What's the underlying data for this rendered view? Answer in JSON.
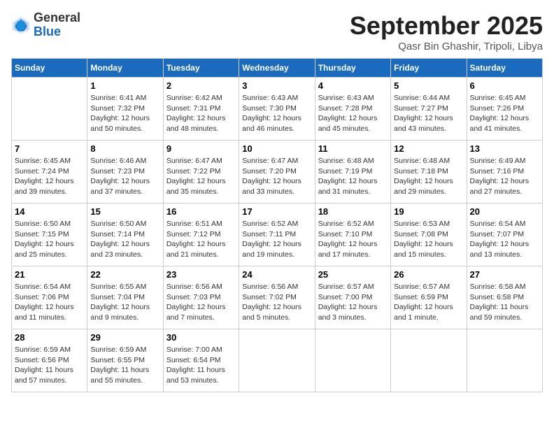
{
  "header": {
    "logo_general": "General",
    "logo_blue": "Blue",
    "month_title": "September 2025",
    "location": "Qasr Bin Ghashir, Tripoli, Libya"
  },
  "weekdays": [
    "Sunday",
    "Monday",
    "Tuesday",
    "Wednesday",
    "Thursday",
    "Friday",
    "Saturday"
  ],
  "weeks": [
    [
      {
        "day": "",
        "sunrise": "",
        "sunset": "",
        "daylight": ""
      },
      {
        "day": "1",
        "sunrise": "Sunrise: 6:41 AM",
        "sunset": "Sunset: 7:32 PM",
        "daylight": "Daylight: 12 hours and 50 minutes."
      },
      {
        "day": "2",
        "sunrise": "Sunrise: 6:42 AM",
        "sunset": "Sunset: 7:31 PM",
        "daylight": "Daylight: 12 hours and 48 minutes."
      },
      {
        "day": "3",
        "sunrise": "Sunrise: 6:43 AM",
        "sunset": "Sunset: 7:30 PM",
        "daylight": "Daylight: 12 hours and 46 minutes."
      },
      {
        "day": "4",
        "sunrise": "Sunrise: 6:43 AM",
        "sunset": "Sunset: 7:28 PM",
        "daylight": "Daylight: 12 hours and 45 minutes."
      },
      {
        "day": "5",
        "sunrise": "Sunrise: 6:44 AM",
        "sunset": "Sunset: 7:27 PM",
        "daylight": "Daylight: 12 hours and 43 minutes."
      },
      {
        "day": "6",
        "sunrise": "Sunrise: 6:45 AM",
        "sunset": "Sunset: 7:26 PM",
        "daylight": "Daylight: 12 hours and 41 minutes."
      }
    ],
    [
      {
        "day": "7",
        "sunrise": "Sunrise: 6:45 AM",
        "sunset": "Sunset: 7:24 PM",
        "daylight": "Daylight: 12 hours and 39 minutes."
      },
      {
        "day": "8",
        "sunrise": "Sunrise: 6:46 AM",
        "sunset": "Sunset: 7:23 PM",
        "daylight": "Daylight: 12 hours and 37 minutes."
      },
      {
        "day": "9",
        "sunrise": "Sunrise: 6:47 AM",
        "sunset": "Sunset: 7:22 PM",
        "daylight": "Daylight: 12 hours and 35 minutes."
      },
      {
        "day": "10",
        "sunrise": "Sunrise: 6:47 AM",
        "sunset": "Sunset: 7:20 PM",
        "daylight": "Daylight: 12 hours and 33 minutes."
      },
      {
        "day": "11",
        "sunrise": "Sunrise: 6:48 AM",
        "sunset": "Sunset: 7:19 PM",
        "daylight": "Daylight: 12 hours and 31 minutes."
      },
      {
        "day": "12",
        "sunrise": "Sunrise: 6:48 AM",
        "sunset": "Sunset: 7:18 PM",
        "daylight": "Daylight: 12 hours and 29 minutes."
      },
      {
        "day": "13",
        "sunrise": "Sunrise: 6:49 AM",
        "sunset": "Sunset: 7:16 PM",
        "daylight": "Daylight: 12 hours and 27 minutes."
      }
    ],
    [
      {
        "day": "14",
        "sunrise": "Sunrise: 6:50 AM",
        "sunset": "Sunset: 7:15 PM",
        "daylight": "Daylight: 12 hours and 25 minutes."
      },
      {
        "day": "15",
        "sunrise": "Sunrise: 6:50 AM",
        "sunset": "Sunset: 7:14 PM",
        "daylight": "Daylight: 12 hours and 23 minutes."
      },
      {
        "day": "16",
        "sunrise": "Sunrise: 6:51 AM",
        "sunset": "Sunset: 7:12 PM",
        "daylight": "Daylight: 12 hours and 21 minutes."
      },
      {
        "day": "17",
        "sunrise": "Sunrise: 6:52 AM",
        "sunset": "Sunset: 7:11 PM",
        "daylight": "Daylight: 12 hours and 19 minutes."
      },
      {
        "day": "18",
        "sunrise": "Sunrise: 6:52 AM",
        "sunset": "Sunset: 7:10 PM",
        "daylight": "Daylight: 12 hours and 17 minutes."
      },
      {
        "day": "19",
        "sunrise": "Sunrise: 6:53 AM",
        "sunset": "Sunset: 7:08 PM",
        "daylight": "Daylight: 12 hours and 15 minutes."
      },
      {
        "day": "20",
        "sunrise": "Sunrise: 6:54 AM",
        "sunset": "Sunset: 7:07 PM",
        "daylight": "Daylight: 12 hours and 13 minutes."
      }
    ],
    [
      {
        "day": "21",
        "sunrise": "Sunrise: 6:54 AM",
        "sunset": "Sunset: 7:06 PM",
        "daylight": "Daylight: 12 hours and 11 minutes."
      },
      {
        "day": "22",
        "sunrise": "Sunrise: 6:55 AM",
        "sunset": "Sunset: 7:04 PM",
        "daylight": "Daylight: 12 hours and 9 minutes."
      },
      {
        "day": "23",
        "sunrise": "Sunrise: 6:56 AM",
        "sunset": "Sunset: 7:03 PM",
        "daylight": "Daylight: 12 hours and 7 minutes."
      },
      {
        "day": "24",
        "sunrise": "Sunrise: 6:56 AM",
        "sunset": "Sunset: 7:02 PM",
        "daylight": "Daylight: 12 hours and 5 minutes."
      },
      {
        "day": "25",
        "sunrise": "Sunrise: 6:57 AM",
        "sunset": "Sunset: 7:00 PM",
        "daylight": "Daylight: 12 hours and 3 minutes."
      },
      {
        "day": "26",
        "sunrise": "Sunrise: 6:57 AM",
        "sunset": "Sunset: 6:59 PM",
        "daylight": "Daylight: 12 hours and 1 minute."
      },
      {
        "day": "27",
        "sunrise": "Sunrise: 6:58 AM",
        "sunset": "Sunset: 6:58 PM",
        "daylight": "Daylight: 11 hours and 59 minutes."
      }
    ],
    [
      {
        "day": "28",
        "sunrise": "Sunrise: 6:59 AM",
        "sunset": "Sunset: 6:56 PM",
        "daylight": "Daylight: 11 hours and 57 minutes."
      },
      {
        "day": "29",
        "sunrise": "Sunrise: 6:59 AM",
        "sunset": "Sunset: 6:55 PM",
        "daylight": "Daylight: 11 hours and 55 minutes."
      },
      {
        "day": "30",
        "sunrise": "Sunrise: 7:00 AM",
        "sunset": "Sunset: 6:54 PM",
        "daylight": "Daylight: 11 hours and 53 minutes."
      },
      {
        "day": "",
        "sunrise": "",
        "sunset": "",
        "daylight": ""
      },
      {
        "day": "",
        "sunrise": "",
        "sunset": "",
        "daylight": ""
      },
      {
        "day": "",
        "sunrise": "",
        "sunset": "",
        "daylight": ""
      },
      {
        "day": "",
        "sunrise": "",
        "sunset": "",
        "daylight": ""
      }
    ]
  ]
}
